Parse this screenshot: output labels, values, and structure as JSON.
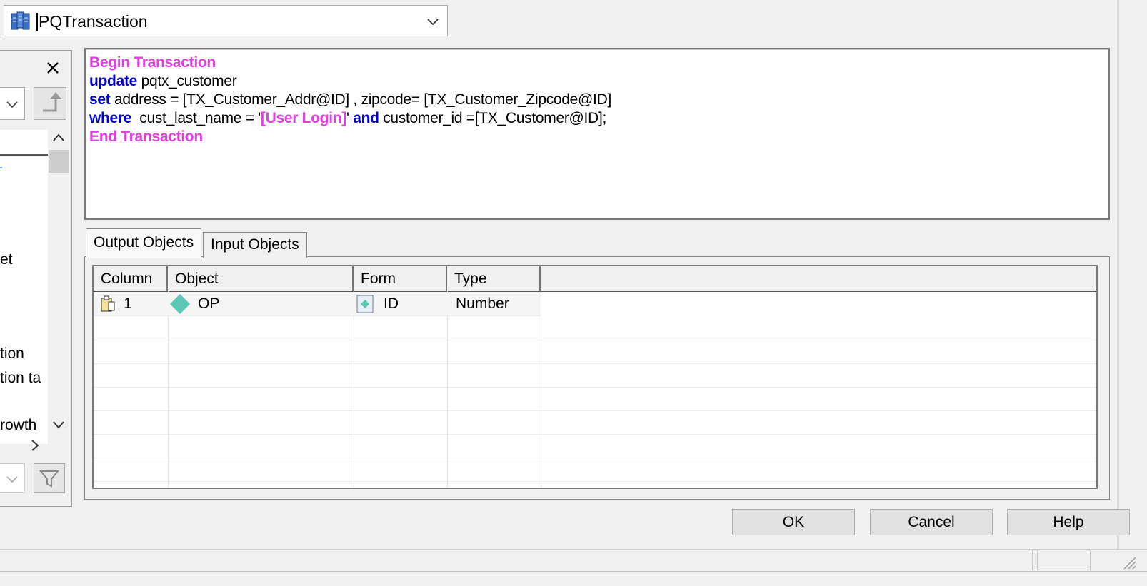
{
  "transaction_combo": {
    "value": "PQTransaction",
    "icon": "database-icon"
  },
  "left_panel": {
    "close_icon": "close-icon",
    "list_items": [
      "et",
      "tion",
      "tion ta",
      "rowth"
    ],
    "scroll_icons": [
      "chevron-up-icon",
      "chevron-down-icon",
      "chevron-right-icon"
    ],
    "filter_icon": "filter-icon"
  },
  "sql_editor": {
    "lines": [
      [
        {
          "text": "Begin Transaction",
          "style": "kw-mag"
        }
      ],
      [
        {
          "text": "update",
          "style": "kw-blue"
        },
        {
          "text": " pqtx_customer",
          "style": "plain"
        }
      ],
      [
        {
          "text": "set",
          "style": "kw-blue"
        },
        {
          "text": " address = [TX_Customer_Addr@ID] , zipcode= [TX_Customer_Zipcode@ID]",
          "style": "plain"
        }
      ],
      [
        {
          "text": "where",
          "style": "kw-blue"
        },
        {
          "text": "  cust_last_name = '",
          "style": "plain"
        },
        {
          "text": "[User Login]",
          "style": "kw-mag"
        },
        {
          "text": "' ",
          "style": "plain"
        },
        {
          "text": "and",
          "style": "kw-blue"
        },
        {
          "text": " customer_id =[TX_Customer@ID];",
          "style": "plain"
        }
      ],
      [
        {
          "text": "End Transaction",
          "style": "kw-mag"
        }
      ]
    ],
    "colors": {
      "keyword_magenta": "#e040e0",
      "keyword_blue": "#0000cc"
    }
  },
  "tabs": {
    "output": "Output Objects",
    "input": "Input Objects",
    "active": "output"
  },
  "grid": {
    "columns": [
      "Column",
      "Object",
      "Form",
      "Type"
    ],
    "rows": [
      {
        "column": "1",
        "object": "OP",
        "form": "ID",
        "type": "Number",
        "column_icon": "clipboard-icon",
        "object_icon": "diamond-icon",
        "form_icon": "form-field-icon"
      }
    ]
  },
  "buttons": {
    "ok": "OK",
    "cancel": "Cancel",
    "help": "Help"
  }
}
